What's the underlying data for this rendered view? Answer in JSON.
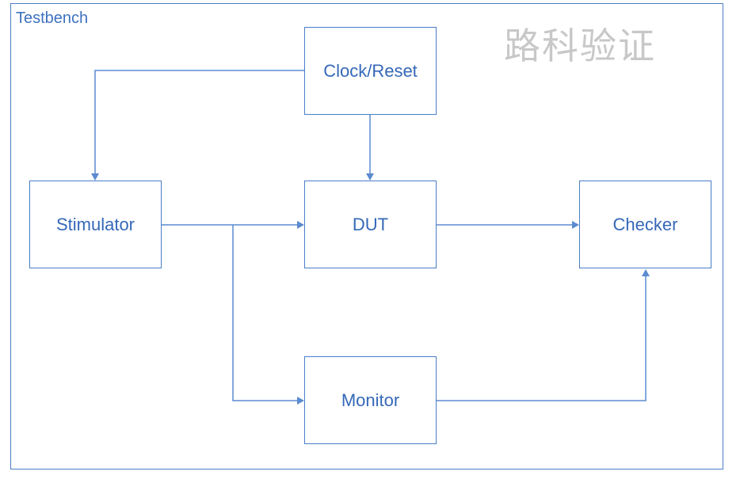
{
  "testbench": {
    "title": "Testbench"
  },
  "watermark": "路科验证",
  "blocks": {
    "clock_reset": "Clock/Reset",
    "stimulator": "Stimulator",
    "dut": "DUT",
    "checker": "Checker",
    "monitor": "Monitor"
  },
  "colors": {
    "border": "#4a7ec8",
    "text": "#3568b8",
    "wire": "#5b8bd0",
    "watermark": "#c8c8c8"
  }
}
